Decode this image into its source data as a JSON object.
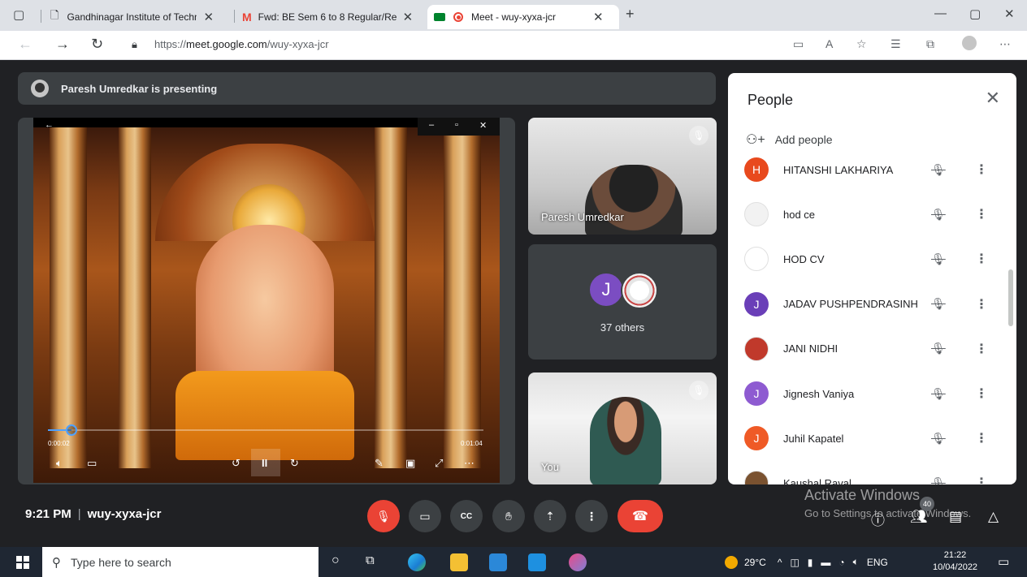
{
  "browser": {
    "tabs": [
      {
        "title": "Gandhinagar Institute of Technol",
        "icon": "page-icon"
      },
      {
        "title": "Fwd: BE Sem 6 to 8 Regular/Rem",
        "icon": "gmail-icon"
      },
      {
        "title": "Meet - wuy-xyxa-jcr",
        "icon": "meet-icon",
        "recording": true
      }
    ],
    "url_prefix": "https://",
    "url_host": "meet.google.com",
    "url_path": "/wuy-xyxa-jcr"
  },
  "meet": {
    "presenting_text": "Paresh Umredkar is presenting",
    "video": {
      "time_elapsed": "0:00:02",
      "time_total": "0:01:04",
      "progress": 0.055
    },
    "tiles": [
      {
        "name": "Paresh Umredkar",
        "muted": true
      },
      {
        "others_count": "37 others",
        "avatar_letter": "J"
      },
      {
        "name": "You",
        "muted": true
      }
    ],
    "time": "9:21 PM",
    "meeting_code": "wuy-xyxa-jcr",
    "people_badge": "40",
    "watermark_line1": "Activate Windows",
    "watermark_line2": "Go to Settings to activate Windows."
  },
  "people_panel": {
    "title": "People",
    "add_people": "Add people",
    "participants": [
      {
        "name": "HITANSHI LAKHARIYA",
        "letter": "H",
        "color": "#e8491d"
      },
      {
        "name": "hod ce",
        "letter": "",
        "color": "#f2f2f2"
      },
      {
        "name": "HOD CV",
        "letter": "",
        "color": "#ffffff"
      },
      {
        "name": "JADAV PUSHPENDRASINH",
        "letter": "J",
        "color": "#6a3fb8"
      },
      {
        "name": "JANI NIDHI",
        "letter": "",
        "color": "#c0392b"
      },
      {
        "name": "Jignesh Vaniya",
        "letter": "J",
        "color": "#8e5bd1"
      },
      {
        "name": "Juhil Kapatel",
        "letter": "J",
        "color": "#ef5a26"
      },
      {
        "name": "Kaushal Raval",
        "letter": "",
        "color": "#7a5230"
      }
    ]
  },
  "taskbar": {
    "search_placeholder": "Type here to search",
    "weather": "29°C",
    "language": "ENG",
    "clock_time": "21:22",
    "clock_date": "10/04/2022"
  }
}
